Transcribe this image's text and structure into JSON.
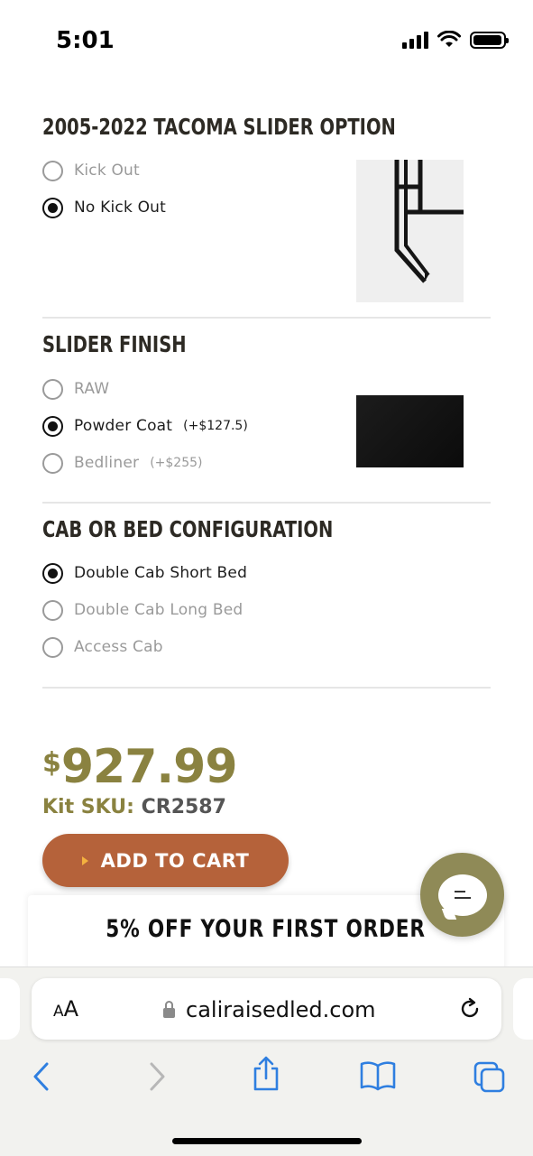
{
  "status": {
    "time": "5:01"
  },
  "sections": [
    {
      "title": "2005-2022 TACOMA SLIDER OPTION",
      "options": [
        {
          "label": "Kick Out",
          "extra": "",
          "selected": false
        },
        {
          "label": "No Kick Out",
          "extra": "",
          "selected": true
        }
      ]
    },
    {
      "title": "SLIDER FINISH",
      "options": [
        {
          "label": "RAW",
          "extra": "",
          "selected": false
        },
        {
          "label": "Powder Coat",
          "extra": "(+$127.5)",
          "selected": true
        },
        {
          "label": "Bedliner",
          "extra": "(+$255)",
          "selected": false
        }
      ]
    },
    {
      "title": "CAB OR BED CONFIGURATION",
      "options": [
        {
          "label": "Double Cab Short Bed",
          "extra": "",
          "selected": true
        },
        {
          "label": "Double Cab Long Bed",
          "extra": "",
          "selected": false
        },
        {
          "label": "Access Cab",
          "extra": "",
          "selected": false
        }
      ]
    }
  ],
  "product": {
    "currency": "$",
    "price": "927.99",
    "sku_label": "Kit SKU:",
    "sku_value": "CR2587",
    "add_to_cart": "ADD TO CART"
  },
  "promo": {
    "text": "5% OFF YOUR FIRST ORDER"
  },
  "browser": {
    "aa_small": "A",
    "aa_large": "A",
    "url": "caliraisedled.com"
  },
  "colors": {
    "accent": "#8a8240",
    "cart_button": "#b5623a",
    "chat_button": "#8f8a57",
    "link_blue": "#2f7fe0"
  },
  "icons": [
    "signal-icon",
    "wifi-icon",
    "battery-icon",
    "chat-icon",
    "lock-icon",
    "reload-icon",
    "back-icon",
    "forward-icon",
    "share-icon",
    "bookmarks-icon",
    "tabs-icon"
  ]
}
